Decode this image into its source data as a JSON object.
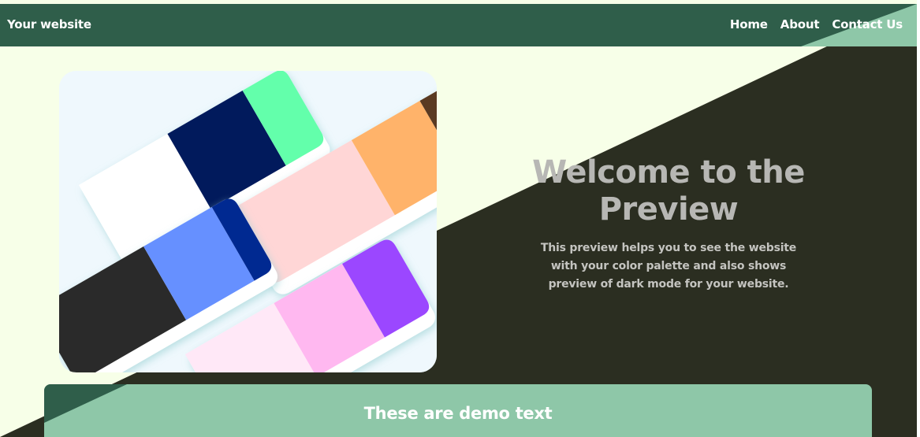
{
  "navbar": {
    "brand": "Your website",
    "links": [
      "Home",
      "About",
      "Contact Us"
    ]
  },
  "hero": {
    "title_line1": "Welcome to the",
    "title_line2": "Preview",
    "description": "This preview helps you to see the website with your color palette and also shows preview of dark mode for your website."
  },
  "demo": {
    "title": "These are demo text"
  },
  "colors": {
    "primary": "#2f5e4a",
    "accent": "#8ec7a8",
    "background_light": "#f7ffe8",
    "background_dark": "#2b2e21",
    "text_light": "#ffffff",
    "text_muted": "#b7b7b4"
  },
  "hero_image": {
    "palette_colors": [
      "#ffffff",
      "#011a5c",
      "#63ffab",
      "#ffd6d6",
      "#ffb36a",
      "#2a2a2a",
      "#6690ff",
      "#002991",
      "#ffe8f7",
      "#ffb8f0",
      "#9b47ff"
    ]
  }
}
